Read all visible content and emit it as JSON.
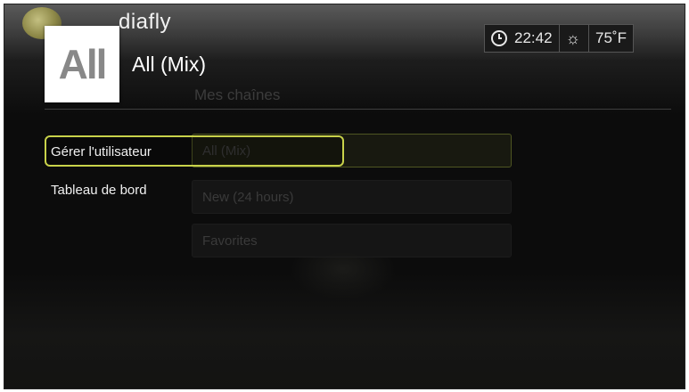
{
  "header": {
    "brand": "diafly",
    "thumbnail_text": "All",
    "title": "All (Mix)",
    "section": "Mes chaînes"
  },
  "status": {
    "time": "22:42",
    "temperature": "75˚F",
    "clock_icon": "clock-icon",
    "weather_icon": "sun-icon"
  },
  "menu": {
    "items": [
      {
        "label": "Gérer l'utilisateur",
        "focused": true
      },
      {
        "label": "Tableau de bord",
        "focused": false
      }
    ]
  },
  "channels": {
    "items": [
      {
        "label": "All (Mix)",
        "selected": true
      },
      {
        "label": "New (24 hours)",
        "selected": false
      },
      {
        "label": "Favorites",
        "selected": false
      }
    ]
  },
  "colors": {
    "focus": "#c8d24a",
    "background": "#0c0c0c"
  }
}
